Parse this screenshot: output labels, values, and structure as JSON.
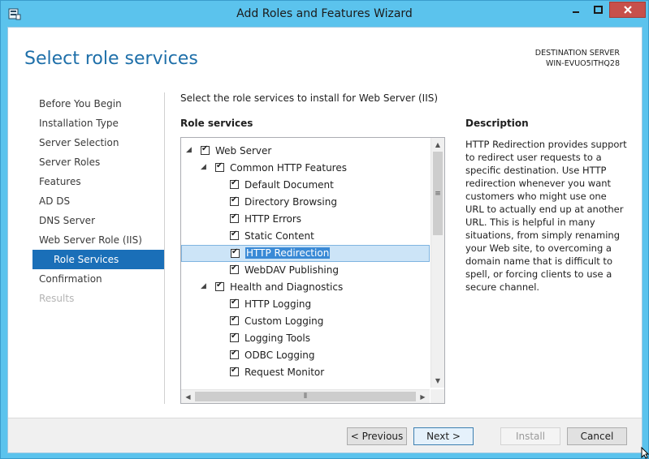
{
  "window": {
    "title": "Add Roles and Features Wizard",
    "icon": "server-manager-icon",
    "controls": [
      "minimize-icon",
      "maximize-icon",
      "close-icon"
    ],
    "accent": "#5bc3ed",
    "close_color": "#c7504b"
  },
  "page": {
    "title": "Select role services",
    "destination_label": "DESTINATION SERVER",
    "destination_server": "WIN-EVUO5ITHQ28"
  },
  "nav": {
    "items": [
      {
        "label": "Before You Begin",
        "state": "normal"
      },
      {
        "label": "Installation Type",
        "state": "normal"
      },
      {
        "label": "Server Selection",
        "state": "normal"
      },
      {
        "label": "Server Roles",
        "state": "normal"
      },
      {
        "label": "Features",
        "state": "normal"
      },
      {
        "label": "AD DS",
        "state": "normal"
      },
      {
        "label": "DNS Server",
        "state": "normal"
      },
      {
        "label": "Web Server Role (IIS)",
        "state": "normal"
      },
      {
        "label": "Role Services",
        "state": "active"
      },
      {
        "label": "Confirmation",
        "state": "normal"
      },
      {
        "label": "Results",
        "state": "disabled"
      }
    ]
  },
  "main": {
    "intro": "Select the role services to install for Web Server (IIS)",
    "role_services_heading": "Role services",
    "tree": [
      {
        "label": "Web Server",
        "level": 0,
        "expanded": true,
        "checked": true
      },
      {
        "label": "Common HTTP Features",
        "level": 1,
        "expanded": true,
        "checked": true
      },
      {
        "label": "Default Document",
        "level": 2,
        "checked": true
      },
      {
        "label": "Directory Browsing",
        "level": 2,
        "checked": true
      },
      {
        "label": "HTTP Errors",
        "level": 2,
        "checked": true
      },
      {
        "label": "Static Content",
        "level": 2,
        "checked": true
      },
      {
        "label": "HTTP Redirection",
        "level": 2,
        "checked": true,
        "selected": true
      },
      {
        "label": "WebDAV Publishing",
        "level": 2,
        "checked": true
      },
      {
        "label": "Health and Diagnostics",
        "level": 1,
        "expanded": true,
        "checked": true
      },
      {
        "label": "HTTP Logging",
        "level": 2,
        "checked": true
      },
      {
        "label": "Custom Logging",
        "level": 2,
        "checked": true
      },
      {
        "label": "Logging Tools",
        "level": 2,
        "checked": true
      },
      {
        "label": "ODBC Logging",
        "level": 2,
        "checked": true
      },
      {
        "label": "Request Monitor",
        "level": 2,
        "checked": true
      }
    ]
  },
  "description": {
    "heading": "Description",
    "text": "HTTP Redirection provides support to redirect user requests to a specific destination. Use HTTP redirection whenever you want customers who might use one URL to actually end up at another URL. This is helpful in many situations, from simply renaming your Web site, to overcoming a domain name that is difficult to spell, or forcing clients to use a secure channel."
  },
  "footer": {
    "previous": "< Previous",
    "next": "Next >",
    "install": "Install",
    "cancel": "Cancel"
  }
}
